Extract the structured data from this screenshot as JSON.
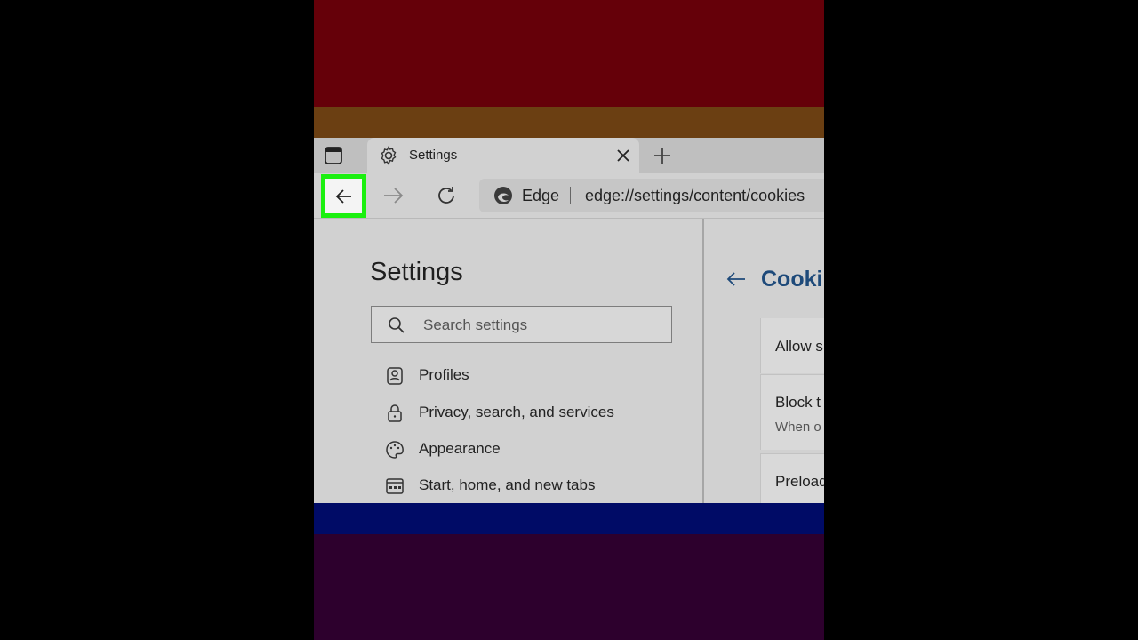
{
  "tab": {
    "title": "Settings"
  },
  "address": {
    "label": "Edge",
    "url": "edge://settings/content/cookies"
  },
  "sidebar": {
    "title": "Settings",
    "search_placeholder": "Search settings",
    "items": [
      {
        "label": "Profiles",
        "icon": "profile-icon"
      },
      {
        "label": "Privacy, search, and services",
        "icon": "lock-icon"
      },
      {
        "label": "Appearance",
        "icon": "palette-icon"
      },
      {
        "label": "Start, home, and new tabs",
        "icon": "start-page-icon"
      }
    ]
  },
  "main": {
    "title": "Cooki",
    "cards": [
      {
        "title": "Allow s"
      },
      {
        "title": "Block t",
        "subtitle": "When o"
      },
      {
        "title": "Preload",
        "subtitle": ""
      }
    ]
  },
  "colors": {
    "highlight": "#1bf00f",
    "link": "#1e4a7a"
  }
}
